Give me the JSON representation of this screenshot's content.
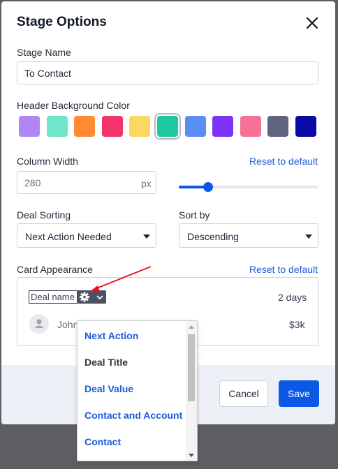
{
  "modal": {
    "title": "Stage Options"
  },
  "stage_name": {
    "label": "Stage Name",
    "value": "To Contact"
  },
  "header_color": {
    "label": "Header Background Color",
    "swatches": [
      "#b086f2",
      "#6ee6c9",
      "#ff8a33",
      "#f2346b",
      "#fbd763",
      "#1ec99f",
      "#5a8ef5",
      "#7d33f5",
      "#f57196",
      "#5f6580",
      "#0a0aa6"
    ],
    "selected_index": 5
  },
  "column_width": {
    "label": "Column Width",
    "reset_label": "Reset to default",
    "value": "280",
    "unit": "px",
    "slider_fraction": 0.22
  },
  "deal_sorting": {
    "label": "Deal Sorting",
    "value": "Next Action Needed"
  },
  "sort_by": {
    "label": "Sort by",
    "value": "Descending"
  },
  "card_appearance": {
    "label": "Card Appearance",
    "reset_label": "Reset to default",
    "field_label": "Deal name",
    "time": "2 days",
    "contact": "John",
    "value": "$3k"
  },
  "footer": {
    "cancel_label": "Cancel",
    "save_label": "Save"
  },
  "field_dropdown": {
    "items": [
      {
        "label": "Next Action",
        "color": "#1e5bd8"
      },
      {
        "label": "Deal Title",
        "color": "#333333"
      },
      {
        "label": "Deal Value",
        "color": "#1e5bd8"
      },
      {
        "label": "Contact and Account",
        "color": "#1e5bd8"
      },
      {
        "label": "Contact",
        "color": "#1e5bd8"
      }
    ]
  },
  "colors": {
    "accent": "#0b57e6",
    "link": "#1e5bd8",
    "annotation_arrow": "#e8141c"
  }
}
